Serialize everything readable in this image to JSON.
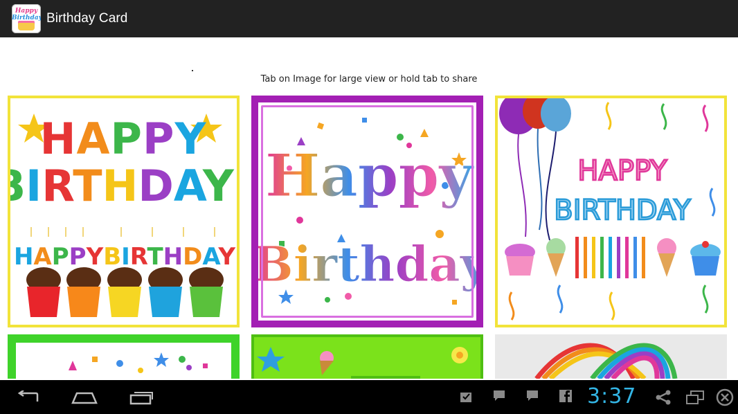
{
  "app": {
    "title": "Birthday Card",
    "icon_lines": [
      "Happy",
      "Birthday"
    ]
  },
  "main": {
    "instruction": "Tab on Image for large view or hold tab to share"
  },
  "cards": [
    {
      "id": "card-1",
      "lines": [
        "HAPPY",
        "BIRTHDAY!"
      ],
      "sub": "HAPPYBIRTHDAY"
    },
    {
      "id": "card-2",
      "lines": [
        "Happy",
        "Birthday"
      ]
    },
    {
      "id": "card-3",
      "lines": [
        "HAPPY",
        "BIRTHDAY"
      ]
    },
    {
      "id": "card-4"
    },
    {
      "id": "card-5"
    },
    {
      "id": "card-6"
    }
  ],
  "statusbar": {
    "clock": "3:37",
    "accent": "#33b5e5"
  },
  "navbar": {
    "back": "back-icon",
    "home": "home-icon",
    "recents": "recent-apps-icon"
  },
  "colors": {
    "actionbar": "#222222",
    "card_yellow_border": "#f2e33a",
    "card_purple_border": "#a31fb4",
    "card_green_border": "#3fd32a"
  }
}
